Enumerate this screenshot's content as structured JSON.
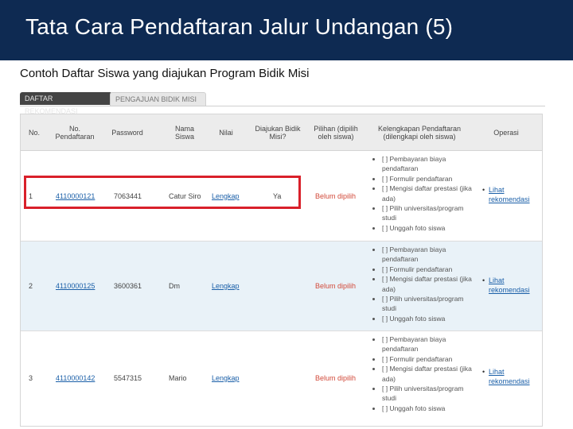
{
  "header": {
    "title": "Tata Cara Pendaftaran Jalur Undangan (5)"
  },
  "subtitle": "Contoh Daftar Siswa yang diajukan Program Bidik Misi",
  "tabs": [
    {
      "label": "DAFTAR REKOMENDASI"
    },
    {
      "label": "PENGAJUAN BIDIK MISI"
    }
  ],
  "table": {
    "headers": {
      "no": "No.",
      "no_pendaftaran": "No. Pendaftaran",
      "password": "Password",
      "nama": "Nama Siswa",
      "nilai": "Nilai",
      "diajukan": "Diajukan Bidik Misi?",
      "pilihan": "Pilihan (dipilih oleh siswa)",
      "kelengkapan": "Kelengkapan Pendaftaran (dilengkapi oleh siswa)",
      "operasi": "Operasi"
    },
    "checklist": [
      "[ ] Pembayaran biaya pendaftaran",
      "[ ] Formulir pendaftaran",
      "[ ] Mengisi daftar prestasi (jika ada)",
      "[ ] Pilih universitas/program studi",
      "[ ] Unggah foto siswa"
    ],
    "rows": [
      {
        "no": "1",
        "no_pendaftaran": "4110000121",
        "password": "7063441",
        "nama": "Catur Siro",
        "nilai": "Lengkap",
        "diajukan": "Ya",
        "pilihan": "Belum dipilih",
        "operasi": "Lihat rekomendasi"
      },
      {
        "no": "2",
        "no_pendaftaran": "4110000125",
        "password": "3600361",
        "nama": "Dm",
        "nilai": "Lengkap",
        "diajukan": "",
        "pilihan": "Belum dipilih",
        "operasi": "Lihat rekomendasi"
      },
      {
        "no": "3",
        "no_pendaftaran": "4110000142",
        "password": "5547315",
        "nama": "Mario",
        "nilai": "Lengkap",
        "diajukan": "",
        "pilihan": "Belum dipilih",
        "operasi": "Lihat rekomendasi"
      }
    ]
  },
  "colors": {
    "title_bar": "#0e2a52",
    "highlight": "#d9202a",
    "link": "#1a5fa8",
    "status_red": "#d24a3a"
  }
}
